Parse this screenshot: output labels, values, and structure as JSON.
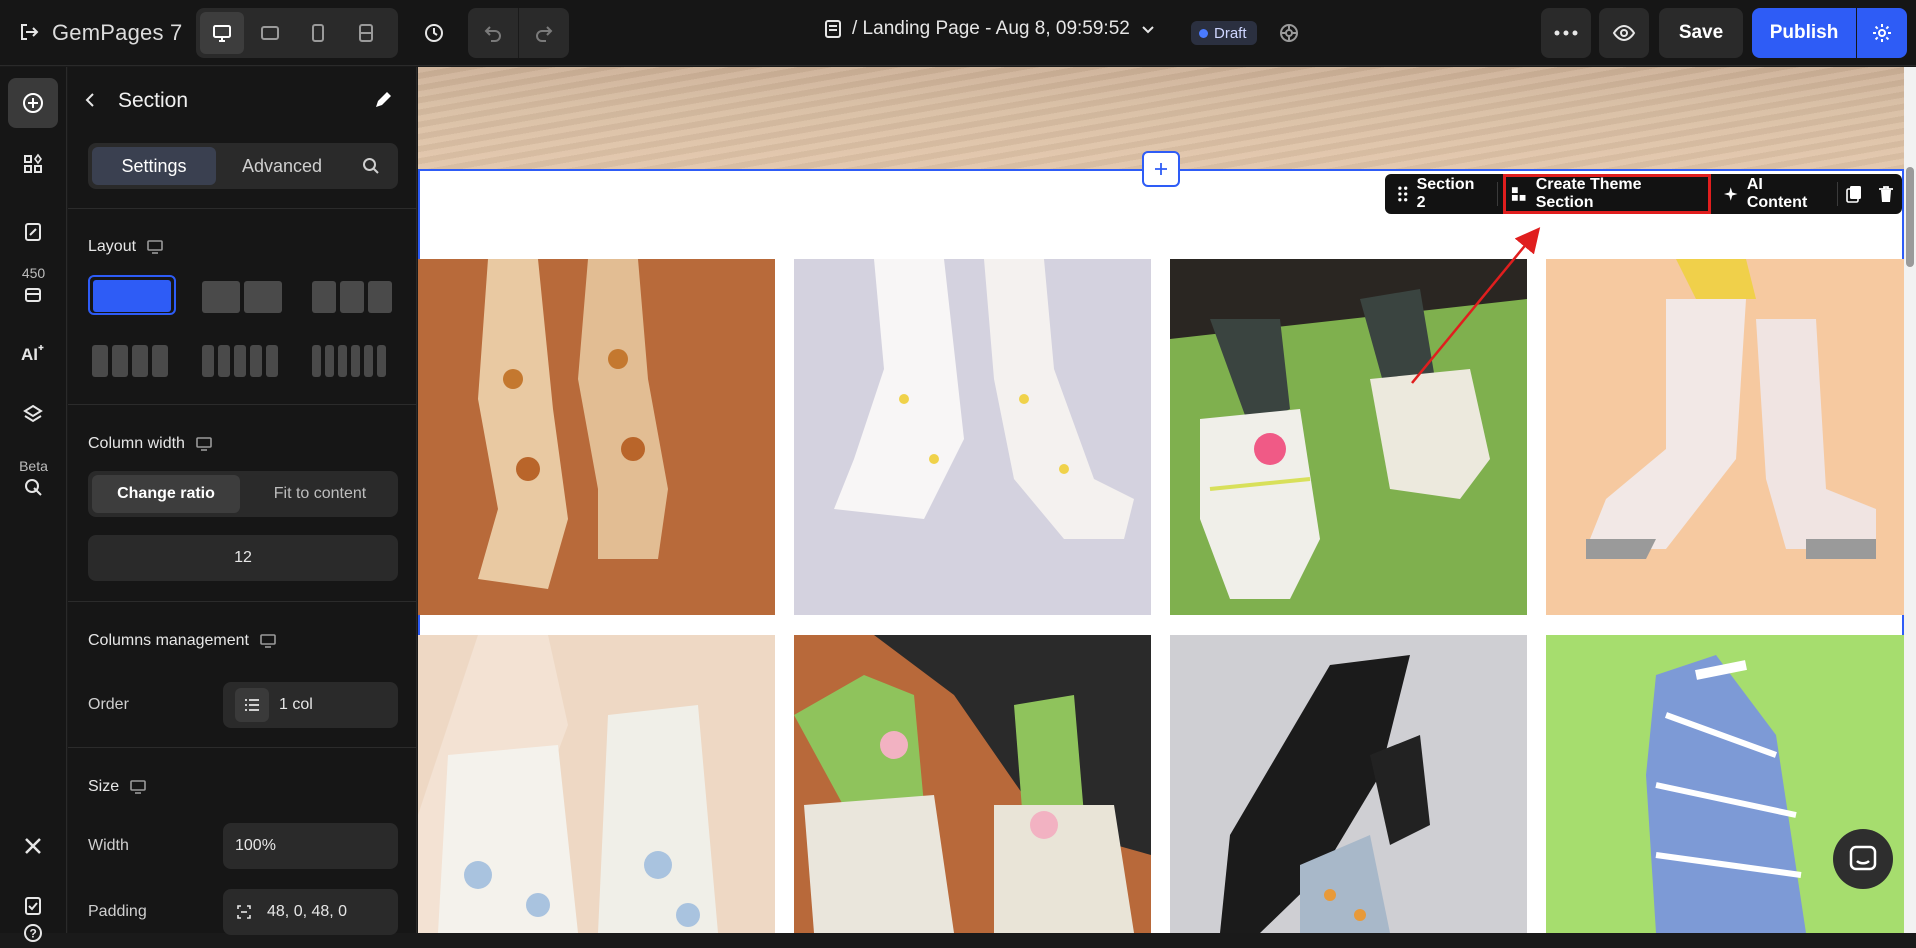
{
  "topbar": {
    "brand": "GemPages",
    "brand_version": "7",
    "page_title": "/ Landing Page - Aug 8, 09:59:52",
    "status_badge": "Draft",
    "save_label": "Save",
    "publish_label": "Publish"
  },
  "rail": {
    "count": "450",
    "beta_label": "Beta"
  },
  "panel": {
    "title": "Section",
    "tabs": [
      "Settings",
      "Advanced"
    ],
    "active_tab": "Settings",
    "layout_label": "Layout",
    "column_width_label": "Column width",
    "column_width_options": [
      "Change ratio",
      "Fit to content"
    ],
    "column_width_active": "Change ratio",
    "column_value": "12",
    "columns_management_label": "Columns management",
    "order_label": "Order",
    "order_value": "1 col",
    "size_label": "Size",
    "width_label": "Width",
    "width_value": "100%",
    "padding_label": "Padding",
    "padding_value": "48, 0, 48, 0"
  },
  "canvas": {
    "section_toolbar": {
      "section_name": "Section 2",
      "create_theme_label": "Create Theme Section",
      "ai_content_label": "AI Content"
    },
    "products": [
      {
        "name": "tiger-socks-photo",
        "bg": "#b86a3a"
      },
      {
        "name": "duck-socks-photo",
        "bg": "#d3d1de"
      },
      {
        "name": "sneaker-socks-photo",
        "bg": "#7fb04e"
      },
      {
        "name": "fuzzy-pink-socks-photo",
        "bg": "#f6c9a0"
      },
      {
        "name": "white-fuzzy-socks-photo",
        "bg": "#eed8c4"
      },
      {
        "name": "horse-socks-photo",
        "bg": "#b8693a"
      },
      {
        "name": "boots-socks-photo",
        "bg": "#cfcfd3"
      },
      {
        "name": "geometric-socks-photo",
        "bg": "#a6dd6e"
      }
    ]
  },
  "colors": {
    "accent": "#2e5cf6",
    "highlight": "#e01e1e",
    "dark_bg": "#161616"
  }
}
